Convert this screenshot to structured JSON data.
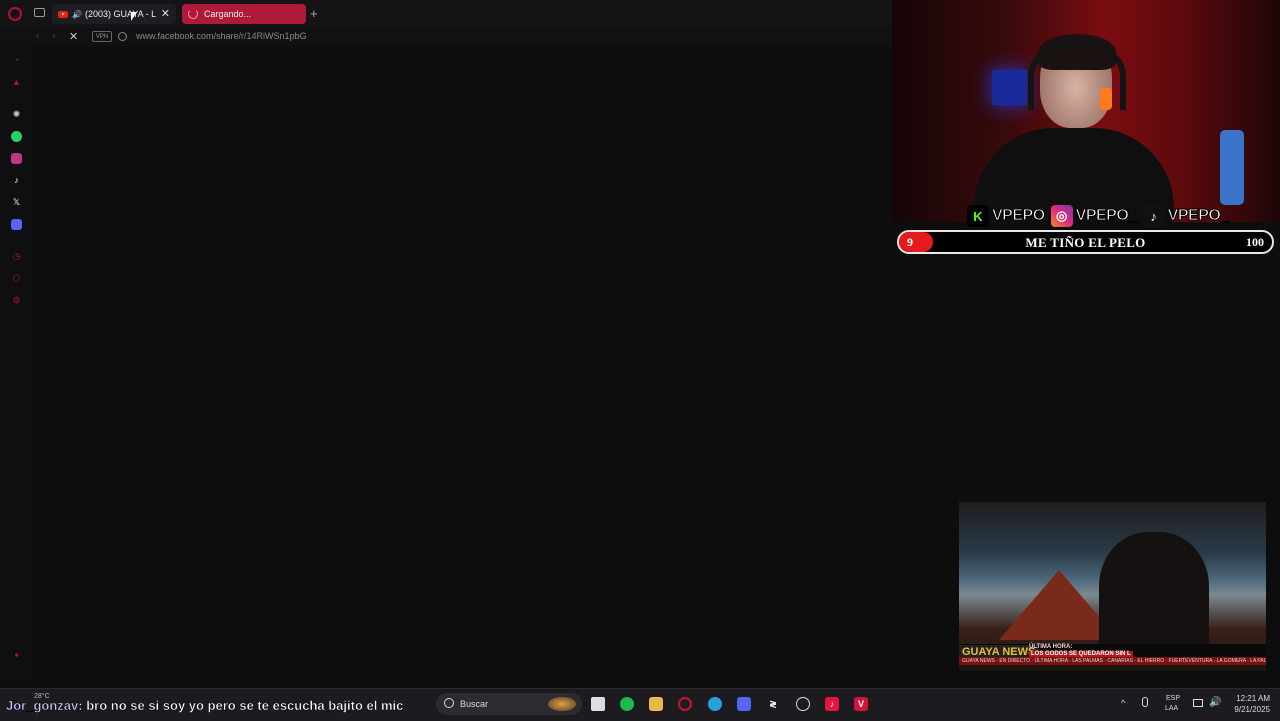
{
  "browser": {
    "tabs": [
      {
        "title": "(2003) GUAYA - L",
        "audio": "🔊"
      },
      {
        "title": "Cargando..."
      }
    ],
    "tab_close_glyph": "✕",
    "new_tab_glyph": "+",
    "address": {
      "back_glyph": "‹",
      "forward_glyph": "›",
      "stop_glyph": "✕",
      "vpn_label": "VPN",
      "url": "www.facebook.com/share/r/14RiWSn1pbG"
    },
    "sidebar_icons": [
      "aria-icon",
      "shopping-icon",
      "chatgpt-icon",
      "whatsapp-icon",
      "instagram-icon",
      "tiktok-icon",
      "x-icon",
      "discord-icon",
      "history-icon",
      "extensions-icon",
      "settings-icon"
    ]
  },
  "overlay": {
    "social": [
      {
        "platform": "kick",
        "glyph": "K",
        "handle": "VPEPO",
        "color": "#53fc18"
      },
      {
        "platform": "instagram",
        "glyph": "◎",
        "handle": "VPEPO_",
        "color": "#c13584"
      },
      {
        "platform": "tiktok",
        "glyph": "♪",
        "handle": "VPEPO_",
        "color": "#111111"
      }
    ],
    "goal": {
      "current": "9",
      "label": "ME TIÑO EL PELO",
      "target": "100",
      "progress_fraction": 0.09
    }
  },
  "news": {
    "logo": "GUAYA NEWS",
    "headline_top": "ÚLTIMA HORA:",
    "headline_main": "LOS GODOS SE QUEDARON SIN L",
    "ticker": "GUAYA NEWS · EN DIRECTO · ÚLTIMA HORA · LAS PALMAS · CANARIAS · EL HIERRO · FUERTEVENTURA · LA GOMERA · LA PALMA"
  },
  "chat": {
    "user": "Jor_gonzav",
    "separator": ": ",
    "message": "bro no se si soy yo pero se te escucha bajito el mic"
  },
  "taskbar": {
    "weather_temp": "28°C",
    "search_placeholder": "Buscar",
    "apps": [
      "file-explorer-icon",
      "spotify-icon",
      "folder-icon",
      "opera-gx-icon",
      "telegram-icon",
      "discord-icon",
      "capcut-icon",
      "settings-icon",
      "tiktok-icon",
      "vivaldi-icon"
    ],
    "tray_up_glyph": "^",
    "lang_line1": "ESP",
    "lang_line2": "LAA",
    "volume_glyph": "🔊",
    "time": "12:21 AM",
    "date": "9/21/2025"
  },
  "colors": {
    "accent": "#b01a3a",
    "goal_fill": "#e41b1b",
    "chrome_bg": "#141416",
    "page_bg": "#0d0d0e"
  }
}
